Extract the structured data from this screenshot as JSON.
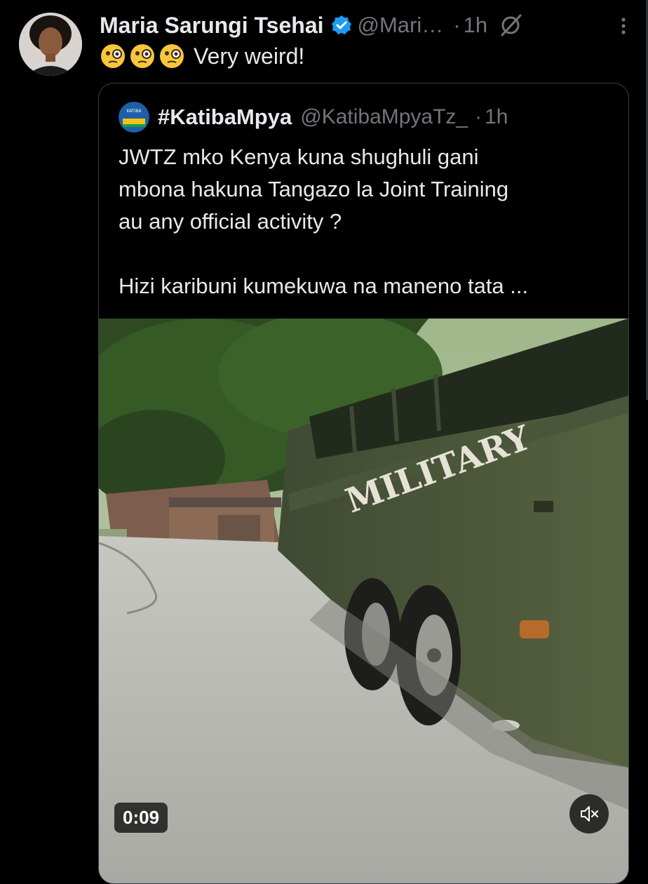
{
  "post": {
    "display_name": "Maria Sarungi Tsehai",
    "handle": "@Mari…",
    "separator": "·",
    "time": "1h",
    "text": "Very weird!",
    "emoji_icons": [
      "face-with-monocle",
      "face-with-monocle",
      "face-with-monocle"
    ],
    "icons": [
      "verified-badge-icon",
      "grok-icon",
      "more-icon"
    ]
  },
  "quoted_post": {
    "display_name": "#KatibaMpya",
    "handle": "@KatibaMpyaTz_",
    "separator": "·",
    "time": "1h",
    "avatar_text": "KATIBA",
    "text": "JWTZ mko Kenya kuna shughuli gani\nmbona hakuna Tangazo la Joint Training\nau any official activity ?\n\nHizi karibuni kumekuwa na maneno tata ...",
    "video": {
      "duration": "0:09",
      "bus_lettering": "MILITARY",
      "mute_icon": "speaker-muted-icon"
    }
  },
  "colors": {
    "background": "#000000",
    "text_primary": "#e7e9ea",
    "text_secondary": "#71767b",
    "verified_blue": "#1d9bf0",
    "border": "#3a3f44"
  }
}
